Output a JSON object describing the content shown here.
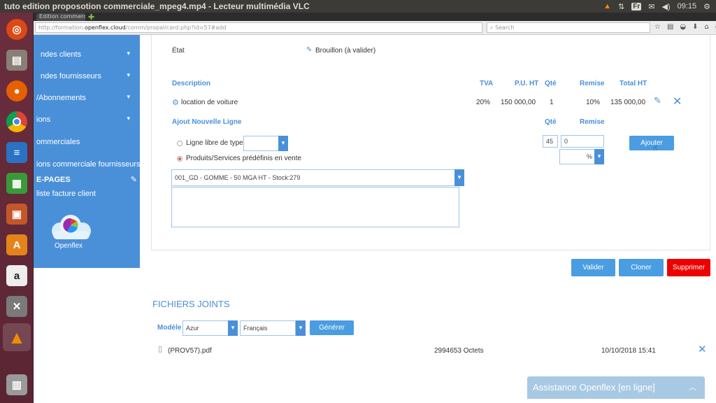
{
  "window": {
    "title": "tuto edition proposotion commerciale_mpeg4.mp4 - Lecteur multimédia VLC"
  },
  "tray": {
    "keyboard": "Fr",
    "time": "09:15"
  },
  "browser": {
    "tab_label": "Edition commerce...",
    "url_prefix": "http://formation.",
    "url_domain": "openflex.cloud",
    "url_suffix": "/comm/propal/card.php?id=57#add",
    "search_placeholder": "Search"
  },
  "sidebar": {
    "items": [
      {
        "label": "ndes clients"
      },
      {
        "label": "ndes fournisseurs"
      },
      {
        "label": "/Abonnements"
      },
      {
        "label": "ions"
      },
      {
        "label": "ommerciales"
      },
      {
        "label": "ions commerciale fournisseurs"
      },
      {
        "label": "E-PAGES"
      },
      {
        "label": "liste facture client"
      }
    ],
    "logo_label": "Openflex"
  },
  "proposal": {
    "state_label": "État",
    "state_value": "Brouillon (à valider)",
    "lines_header": {
      "description": "Description",
      "vat": "TVA",
      "unit_price": "P.U. HT",
      "qty": "Qté",
      "discount": "Remise",
      "total": "Total HT"
    },
    "lines": [
      {
        "description": "location de voiture",
        "vat": "20%",
        "unit_price": "150 000,00",
        "qty": "1",
        "discount": "10%",
        "total": "135 000,00"
      }
    ],
    "new_line": {
      "title": "Ajout Nouvelle Ligne",
      "qty_header": "Qté",
      "discount_header": "Remise",
      "free_line_label": "Ligne libre de type",
      "predefined_label": "Produits/Services prédéfinis en vente",
      "product_value": "001_GD - GOMME - 50 MGA HT - Stock:279",
      "qty_value": "45",
      "discount_value": "0",
      "discount_unit": "%",
      "add_button": "Ajouter"
    }
  },
  "actions": {
    "validate": "Valider",
    "clone": "Cloner",
    "delete": "Supprimer"
  },
  "attachments": {
    "title": "FICHIERS JOINTS",
    "model_label": "Modèle",
    "model_value": "Azur",
    "language_value": "Français",
    "generate_button": "Générer",
    "files": [
      {
        "name": "(PROV57).pdf",
        "size": "2994653 Octets",
        "date": "10/10/2018 15:41"
      }
    ]
  },
  "chat": {
    "label": "Assistance Openflex [en ligne]"
  }
}
